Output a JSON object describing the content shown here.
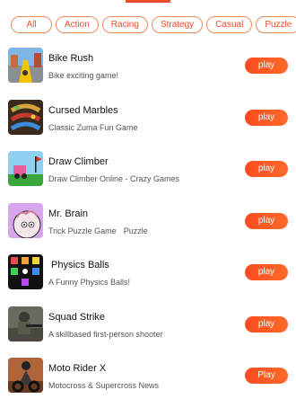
{
  "filters": [
    "All",
    "Action",
    "Racing",
    "Strategy",
    "Casual",
    "Puzzle"
  ],
  "games": [
    {
      "title": "Bike Rush",
      "subtitle": "Bike exciting game!",
      "tag": "",
      "button": "play",
      "icon": "bike-rush-icon"
    },
    {
      "title": "Cursed Marbles",
      "subtitle": "Classic Zuma Fun Game",
      "tag": "",
      "button": "play",
      "icon": "cursed-marbles-icon"
    },
    {
      "title": "Draw Climber",
      "subtitle": "Draw Climber Online - Crazy Games",
      "tag": "",
      "button": "play",
      "icon": "draw-climber-icon"
    },
    {
      "title": "Mr. Brain",
      "subtitle": "Trick Puzzle Game",
      "tag": "Puzzle",
      "button": "play",
      "icon": "mr-brain-icon"
    },
    {
      "title": "Physics Balls",
      "subtitle": "A Funny Physics Balls!",
      "tag": "",
      "button": "play",
      "icon": "physics-balls-icon"
    },
    {
      "title": "Squad Strike",
      "subtitle": "A skillbased first-person shooter",
      "tag": "",
      "button": "play",
      "icon": "squad-strike-icon"
    },
    {
      "title": "Moto Rider X",
      "subtitle": "Motocross & Supercross News",
      "tag": "",
      "button": "Play",
      "icon": "moto-rider-x-icon"
    }
  ],
  "colors": {
    "accent": "#ee4d2d",
    "chip_border": "#f08a5d"
  }
}
